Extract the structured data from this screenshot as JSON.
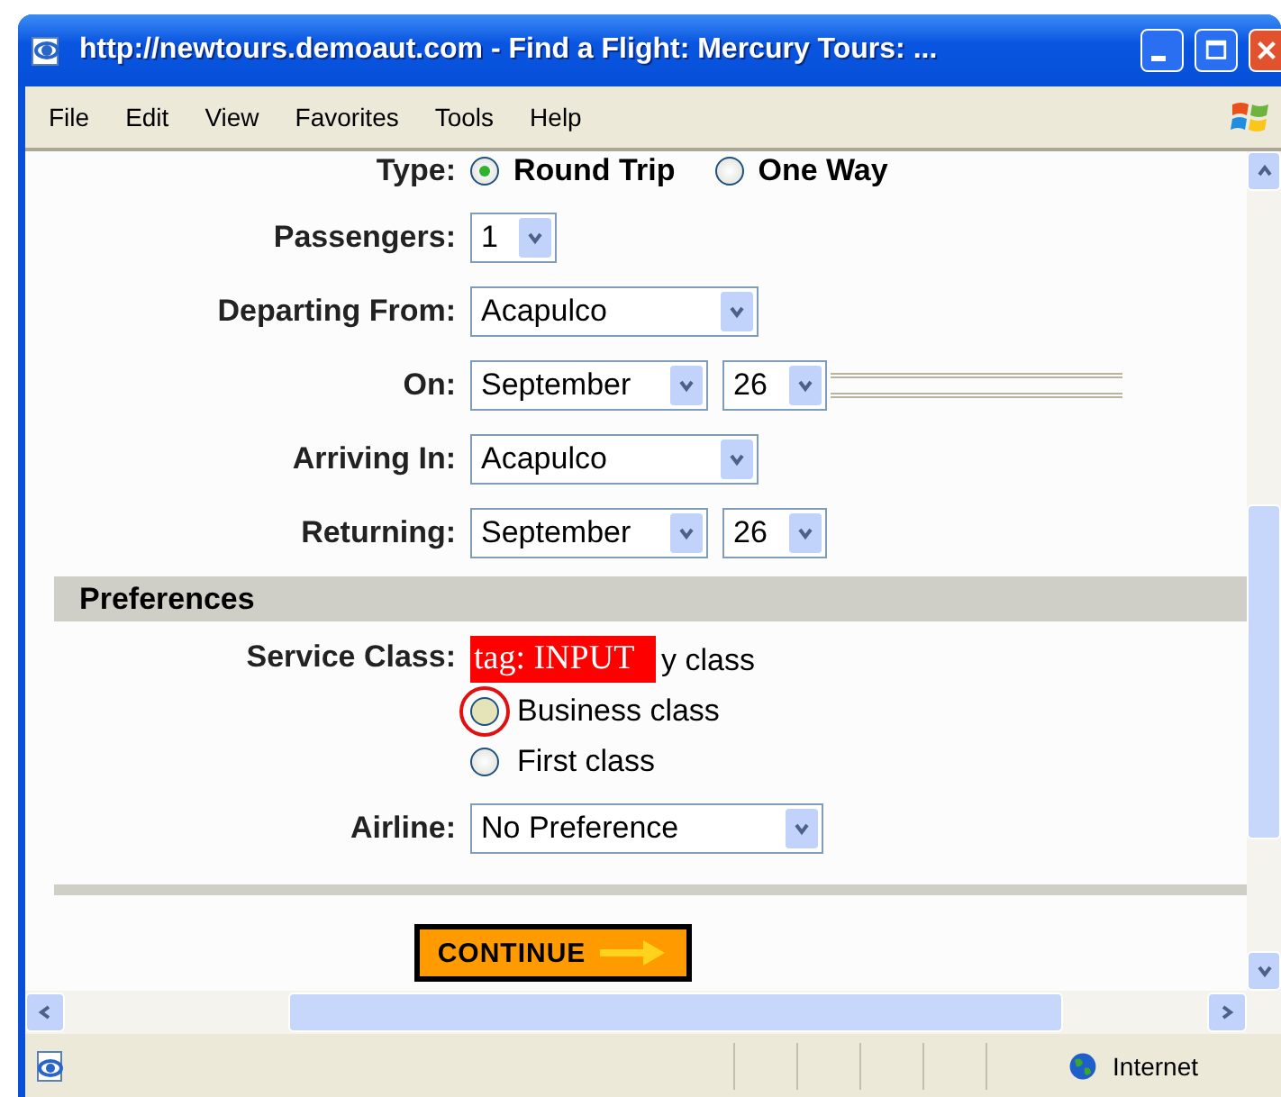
{
  "window": {
    "title": "http://newtours.demoaut.com - Find a Flight: Mercury Tours: ..."
  },
  "menu": [
    "File",
    "Edit",
    "View",
    "Favorites",
    "Tools",
    "Help"
  ],
  "type": {
    "label": "Type:",
    "options": [
      {
        "label": "Round Trip",
        "selected": true
      },
      {
        "label": "One Way",
        "selected": false
      }
    ]
  },
  "passengers": {
    "label": "Passengers:",
    "value": "1"
  },
  "departing_from": {
    "label": "Departing From:",
    "value": "Acapulco"
  },
  "on": {
    "label": "On:",
    "month": "September",
    "day": "26"
  },
  "arriving_in": {
    "label": "Arriving In:",
    "value": "Acapulco"
  },
  "returning": {
    "label": "Returning:",
    "month": "September",
    "day": "26"
  },
  "preferences": {
    "title": "Preferences"
  },
  "service_class": {
    "label": "Service Class:",
    "tag_overlay": "tag: INPUT",
    "options": [
      {
        "kind": "covered",
        "label": "y class"
      },
      {
        "kind": "radio",
        "label": "Business class",
        "selected": false,
        "highlighted": true
      },
      {
        "kind": "radio",
        "label": "First class",
        "selected": false,
        "highlighted": false
      }
    ]
  },
  "airline": {
    "label": "Airline:",
    "value": "No Preference"
  },
  "continue_button": {
    "label": "CONTINUE"
  },
  "status_bar": {
    "zone": "Internet"
  }
}
